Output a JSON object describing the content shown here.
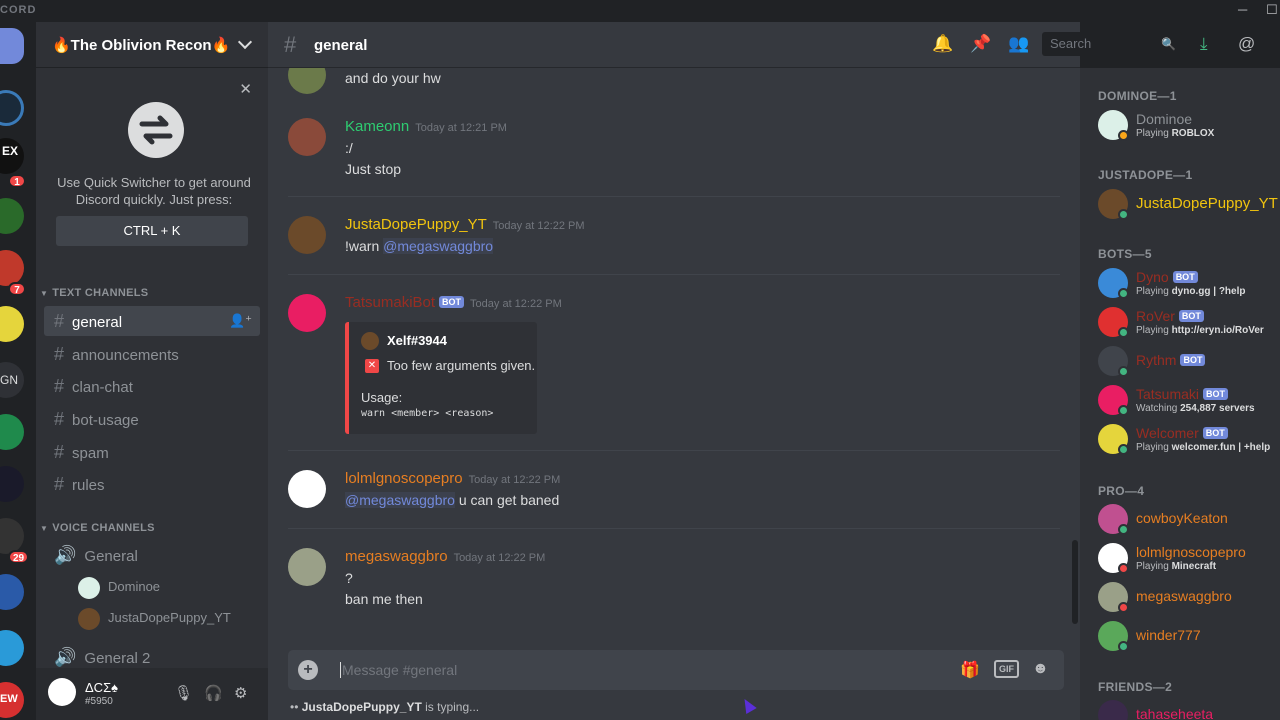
{
  "app": {
    "brand": "CORD"
  },
  "server": {
    "name": "🔥The Oblivion Recon🔥"
  },
  "guild_badges": [
    "1",
    "7",
    "29"
  ],
  "guild_labels": [
    "EX",
    "GN",
    "EW"
  ],
  "quick_switcher": {
    "text": "Use Quick Switcher to get around Discord quickly. Just press:",
    "shortcut": "CTRL + K"
  },
  "sidebar": {
    "text_category": "TEXT CHANNELS",
    "text_channels": [
      "general",
      "announcements",
      "clan-chat",
      "bot-usage",
      "spam",
      "rules"
    ],
    "voice_category": "VOICE CHANNELS",
    "voice_channels": [
      "General",
      "General 2"
    ],
    "voice_users": [
      "Dominoe",
      "JustaDopePuppy_YT"
    ]
  },
  "user": {
    "name": "ΔCΣ♠",
    "tag": "#5950"
  },
  "channel": {
    "name": "general"
  },
  "search": {
    "placeholder": "Search"
  },
  "messages": [
    {
      "text": "and do your hw"
    },
    {
      "author": "Kameonn",
      "time": "Today at 12:21 PM",
      "lines": [
        ":/",
        "Just stop"
      ]
    },
    {
      "author": "JustaDopePuppy_YT",
      "time": "Today at 12:22 PM",
      "mention": "@megaswaggbro",
      "prefix": "!warn "
    },
    {
      "author": "TatsumakiBot",
      "badge": "BOT",
      "time": "Today at 12:22 PM",
      "embed": {
        "author": "Xelf#3944",
        "description": "Too few arguments given.",
        "usage_label": "Usage:",
        "usage_code": "warn <member> <reason>"
      }
    },
    {
      "author": "lolmlgnoscopepro",
      "time": "Today at 12:22 PM",
      "mention": "@megaswaggbro",
      "rest": " u can get baned"
    },
    {
      "author": "megaswaggbro",
      "time": "Today at 12:22 PM",
      "lines": [
        "?",
        "ban me then"
      ]
    }
  ],
  "composer": {
    "placeholder": "Message #general",
    "gif": "GIF"
  },
  "typing": {
    "user": "JustaDopePuppy_YT",
    "suffix": " is typing..."
  },
  "members": {
    "cat1": "DOMINOE—1",
    "cat2": "JUSTADOPE—1",
    "cat3": "BOTS—5",
    "cat4": "PRO—4",
    "cat5": "FRIENDS—2",
    "list": [
      {
        "name": "Dominoe",
        "activity_prefix": "Playing ",
        "activity": "ROBLOX"
      },
      {
        "name": "JustaDopePuppy_YT"
      },
      {
        "name": "Dyno",
        "badge": "BOT",
        "activity_prefix": "Playing ",
        "activity": "dyno.gg | ?help"
      },
      {
        "name": "RoVer",
        "badge": "BOT",
        "activity_prefix": "Playing ",
        "activity": "http://eryn.io/RoVer"
      },
      {
        "name": "Rythm",
        "badge": "BOT"
      },
      {
        "name": "Tatsumaki",
        "badge": "BOT",
        "activity_prefix": "Watching ",
        "activity": "254,887 servers"
      },
      {
        "name": "Welcomer",
        "badge": "BOT",
        "activity_prefix": "Playing ",
        "activity": "welcomer.fun | +help"
      },
      {
        "name": "cowboyKeaton"
      },
      {
        "name": "lolmlgnoscopepro",
        "activity_prefix": "Playing ",
        "activity": "Minecraft"
      },
      {
        "name": "megaswaggbro"
      },
      {
        "name": "winder777"
      },
      {
        "name": "tahaseheeta"
      }
    ]
  },
  "colors": {
    "accent": "#7289da",
    "online": "#43b581",
    "dnd": "#f04747",
    "orange": "#e67e22",
    "yellow": "#f1c40f",
    "green": "#2ecc71",
    "red": "#992d22"
  }
}
